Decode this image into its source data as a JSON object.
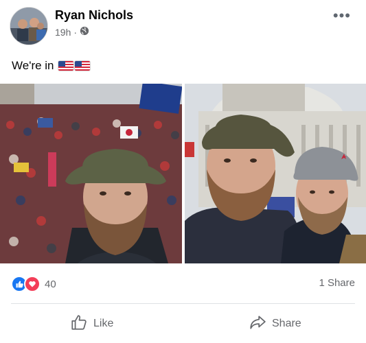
{
  "post": {
    "author": "Ryan Nichols",
    "time": "19h",
    "separator": "·",
    "caption": "We're in",
    "caption_flags": [
      "flag-us",
      "flag-us"
    ]
  },
  "photos": [
    {
      "name": "capitol-crowd-selfie"
    },
    {
      "name": "capitol-building-selfie"
    }
  ],
  "stats": {
    "reaction_icons": [
      "like-reaction-icon",
      "love-reaction-icon"
    ],
    "reaction_count": "40",
    "share_count": "1 Share"
  },
  "actions": {
    "like_label": "Like",
    "share_label": "Share"
  },
  "colors": {
    "brand_blue": "#1877f2",
    "love_red": "#f33e58",
    "secondary_text": "#65676b"
  }
}
